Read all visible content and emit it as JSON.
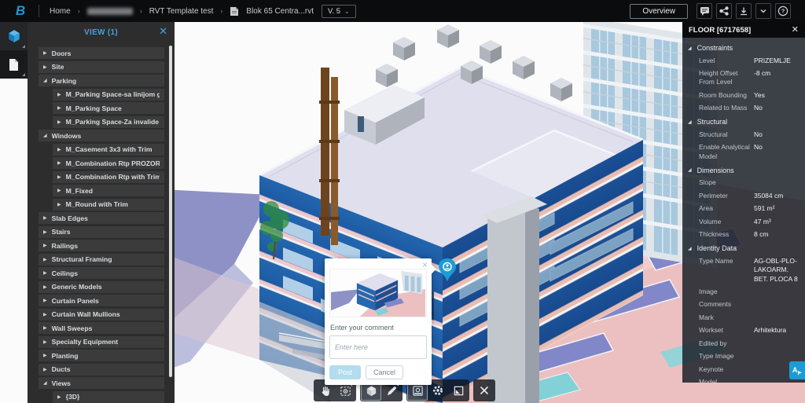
{
  "topbar": {
    "logo_letter": "B",
    "breadcrumb": [
      {
        "label": "Home",
        "redacted": false
      },
      {
        "label": "",
        "redacted": true
      },
      {
        "label": "RVT Template test",
        "redacted": false
      },
      {
        "label": "Blok 65 Centra...rvt",
        "redacted": false,
        "icon": "rvt-file"
      }
    ],
    "version_label": "V. 5",
    "overview_label": "Overview",
    "icon_buttons": [
      "comment-icon",
      "share-icon",
      "download-icon",
      "chevron-down-icon",
      "help-icon"
    ]
  },
  "left_rail": {
    "icons": [
      "model-cube-icon",
      "document-icon"
    ]
  },
  "tree_panel": {
    "title": "VIEW (1)",
    "items": [
      {
        "label": "Doors",
        "level": 0,
        "expanded": false
      },
      {
        "label": "Site",
        "level": 0,
        "expanded": false
      },
      {
        "label": "Parking",
        "level": 0,
        "expanded": true
      },
      {
        "label": "M_Parking Space-sa linijom gore",
        "level": 1,
        "expanded": false
      },
      {
        "label": "M_Parking Space",
        "level": 1,
        "expanded": false
      },
      {
        "label": "M_Parking Space-Za invalide",
        "level": 1,
        "expanded": false
      },
      {
        "label": "Windows",
        "level": 0,
        "expanded": true
      },
      {
        "label": "M_Casement 3x3 with Trim",
        "level": 1,
        "expanded": false
      },
      {
        "label": "M_Combination Rtp PROZOR",
        "level": 1,
        "expanded": false
      },
      {
        "label": "M_Combination Rtp with Trim",
        "level": 1,
        "expanded": false
      },
      {
        "label": "M_Fixed",
        "level": 1,
        "expanded": false
      },
      {
        "label": "M_Round with Trim",
        "level": 1,
        "expanded": false
      },
      {
        "label": "Slab Edges",
        "level": 0,
        "expanded": false
      },
      {
        "label": "Stairs",
        "level": 0,
        "expanded": false
      },
      {
        "label": "Railings",
        "level": 0,
        "expanded": false
      },
      {
        "label": "Structural Framing",
        "level": 0,
        "expanded": false
      },
      {
        "label": "Ceilings",
        "level": 0,
        "expanded": false
      },
      {
        "label": "Generic Models",
        "level": 0,
        "expanded": false
      },
      {
        "label": "Curtain Panels",
        "level": 0,
        "expanded": false
      },
      {
        "label": "Curtain Wall Mullions",
        "level": 0,
        "expanded": false
      },
      {
        "label": "Wall Sweeps",
        "level": 0,
        "expanded": false
      },
      {
        "label": "Specialty Equipment",
        "level": 0,
        "expanded": false
      },
      {
        "label": "Planting",
        "level": 0,
        "expanded": false
      },
      {
        "label": "Ducts",
        "level": 0,
        "expanded": false
      },
      {
        "label": "Views",
        "level": 0,
        "expanded": true
      },
      {
        "label": "{3D}",
        "level": 1,
        "expanded": false
      }
    ]
  },
  "properties_panel": {
    "title": "FLOOR [6717658]",
    "sections": [
      {
        "name": "Constraints",
        "rows": [
          {
            "label": "Level",
            "value": "PRIZEMLJE"
          },
          {
            "label": "Height Offset From Level",
            "value": "-8 cm"
          },
          {
            "label": "Room Bounding",
            "value": "Yes"
          },
          {
            "label": "Related to Mass",
            "value": "No"
          }
        ]
      },
      {
        "name": "Structural",
        "rows": [
          {
            "label": "Structural",
            "value": "No"
          },
          {
            "label": "Enable Analytical Model",
            "value": "No"
          }
        ]
      },
      {
        "name": "Dimensions",
        "rows": [
          {
            "label": "Slope",
            "value": ""
          },
          {
            "label": "Perimeter",
            "value": "35084 cm"
          },
          {
            "label": "Area",
            "value": "591 m²"
          },
          {
            "label": "Volume",
            "value": "47 m³"
          },
          {
            "label": "Thickness",
            "value": "8 cm"
          }
        ]
      },
      {
        "name": "Identity Data",
        "rows": [
          {
            "label": "Type Name",
            "value": "AG-OBL-PLO-LAKOARM. BET. PLOCA 8"
          },
          {
            "label": "Image",
            "value": ""
          },
          {
            "label": "Comments",
            "value": ""
          },
          {
            "label": "Mark",
            "value": ""
          },
          {
            "label": "Workset",
            "value": "Arhitektura"
          },
          {
            "label": "Edited by",
            "value": ""
          },
          {
            "label": "Type Image",
            "value": ""
          },
          {
            "label": "Keynote",
            "value": ""
          },
          {
            "label": "Model",
            "value": ""
          }
        ]
      }
    ]
  },
  "comment_popup": {
    "label": "Enter your comment",
    "placeholder": "Enter here",
    "post_label": "Post",
    "cancel_label": "Cancel"
  },
  "toolbar": {
    "buttons": [
      "pan",
      "section-select",
      "home-3d",
      "markup-pen",
      "snapshot",
      "settings",
      "fullscreen",
      "close"
    ]
  },
  "colors": {
    "accent_blue": "#1e9bd6",
    "tree_header_blue": "#41a3dc",
    "topbar_bg": "#0b0c0e",
    "panel_bg": "#2d2d2e",
    "props_bg": "rgba(33,37,45,0.88)"
  }
}
